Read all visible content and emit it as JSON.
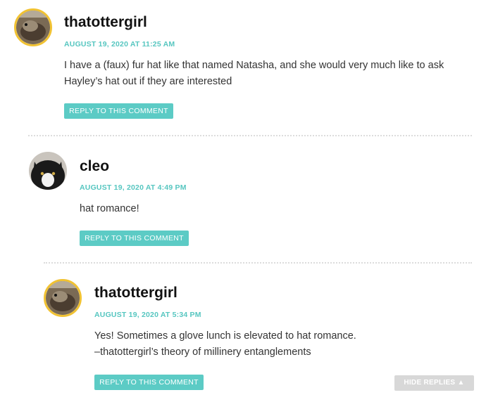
{
  "comments": [
    {
      "author": "thatottergirl",
      "date": "AUGUST 19, 2020 AT 11:25 AM",
      "lines": [
        "I have a (faux) fur hat like that named Natasha, and she would very much like to ask",
        "Hayley’s hat out if they are interested"
      ],
      "reply_label": "REPLY TO THIS COMMENT",
      "avatar": "otter-avatar"
    },
    {
      "author": "cleo",
      "date": "AUGUST 19, 2020 AT 4:49 PM",
      "lines": [
        "hat romance!"
      ],
      "reply_label": "REPLY TO THIS COMMENT",
      "avatar": "cat-avatar"
    },
    {
      "author": "thatottergirl",
      "date": "AUGUST 19, 2020 AT 5:34 PM",
      "lines": [
        "Yes! Sometimes a glove lunch is elevated to hat romance.",
        "–thatottergirl’s theory of millinery entanglements"
      ],
      "reply_label": "REPLY TO THIS COMMENT",
      "avatar": "otter-avatar"
    }
  ],
  "hide_replies_label": "HIDE REPLIES ▲",
  "colors": {
    "accent": "#5ccbc5",
    "date": "#56c6c0",
    "ring": "#f1c232",
    "hide": "#d8d8d8"
  }
}
